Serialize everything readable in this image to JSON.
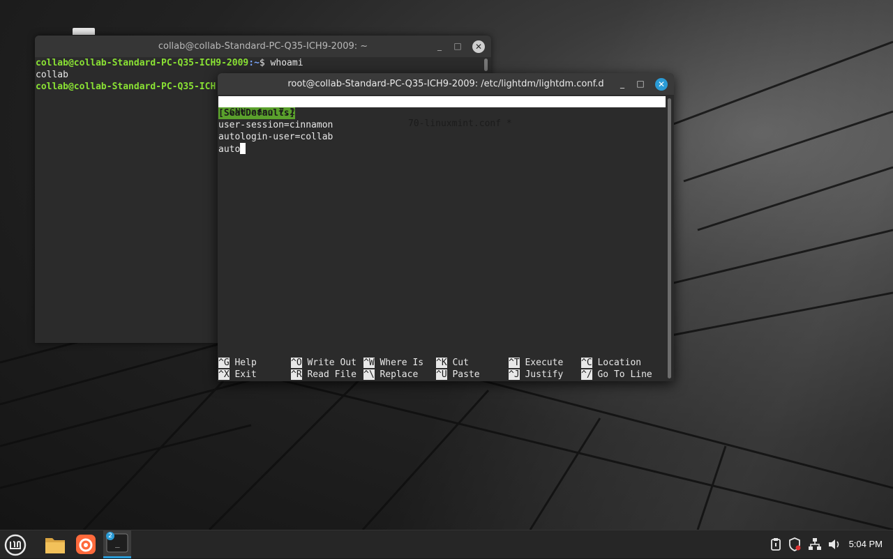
{
  "back_terminal": {
    "title": "collab@collab-Standard-PC-Q35-ICH9-2009: ~",
    "lines": [
      {
        "user": "collab@collab-Standard-PC-Q35-ICH9-2009",
        "path": ":~",
        "cmd": "$ whoami"
      },
      {
        "output": "collab"
      },
      {
        "user": "collab@collab-Standard-PC-Q35-ICH",
        "path": "",
        "cmd": ""
      }
    ]
  },
  "front_terminal": {
    "title": "root@collab-Standard-PC-Q35-ICH9-2009: /etc/lightdm/lightdm.conf.d",
    "nano": {
      "version": "GNU nano 7.2",
      "filename": "70-linuxmint.conf *",
      "section": "[SeatDefaults]",
      "line1": "user-session=cinnamon",
      "line2": "autologin-user=collab",
      "line3": "auto",
      "shortcuts_row1": [
        {
          "key": "^G",
          "label": "Help"
        },
        {
          "key": "^O",
          "label": "Write Out"
        },
        {
          "key": "^W",
          "label": "Where Is"
        },
        {
          "key": "^K",
          "label": "Cut"
        },
        {
          "key": "^T",
          "label": "Execute"
        },
        {
          "key": "^C",
          "label": "Location"
        }
      ],
      "shortcuts_row2": [
        {
          "key": "^X",
          "label": "Exit"
        },
        {
          "key": "^R",
          "label": "Read File"
        },
        {
          "key": "^\\",
          "label": "Replace"
        },
        {
          "key": "^U",
          "label": "Paste"
        },
        {
          "key": "^J",
          "label": "Justify"
        },
        {
          "key": "^/",
          "label": "Go To Line"
        }
      ]
    }
  },
  "window_controls": {
    "minimize": "_",
    "maximize": "□",
    "close": "✕"
  },
  "taskbar": {
    "menu_icon": "linux-mint-menu-icon",
    "files_icon": "folder-icon",
    "firefox_icon": "firefox-icon",
    "terminal_icon": "terminal-icon",
    "terminal_badge": "2",
    "terminal_glyph": "_",
    "tray_icons": [
      "clipboard-icon",
      "shield-icon",
      "network-icon",
      "volume-icon"
    ],
    "clock": "5:04 PM"
  },
  "colors": {
    "accent": "#2a9bd6",
    "prompt_green": "#8ae234",
    "section_green": "#5aa02c"
  }
}
